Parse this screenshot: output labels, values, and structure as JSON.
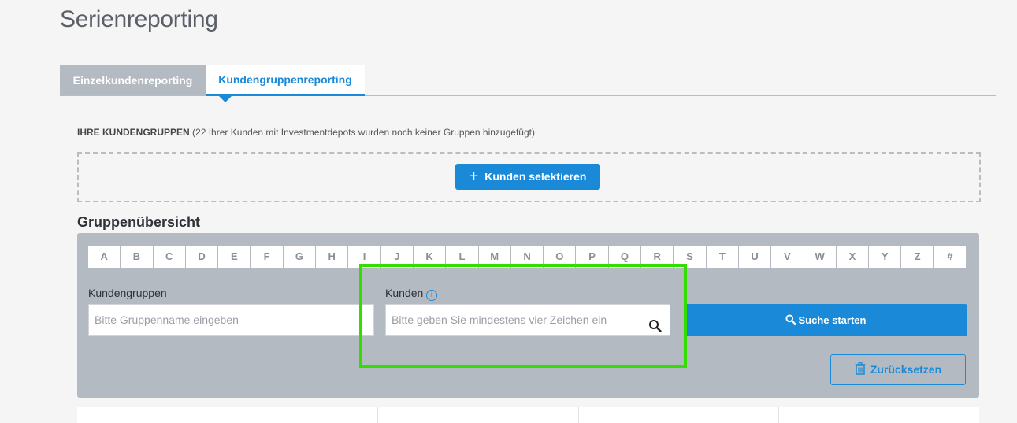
{
  "page_title": "Serienreporting",
  "tabs": [
    {
      "label": "Einzelkundenreporting",
      "active": false
    },
    {
      "label": "Kundengruppenreporting",
      "active": true
    }
  ],
  "groups": {
    "heading": "IHRE KUNDENGRUPPEN",
    "note": "(22 Ihrer Kunden mit Investmentdepots wurden noch keiner Gruppen hinzugefügt)",
    "select_button": "Kunden selektieren",
    "select_icon": "plus-icon"
  },
  "overview": {
    "title": "Gruppenübersicht",
    "letters": [
      "A",
      "B",
      "C",
      "D",
      "E",
      "F",
      "G",
      "H",
      "I",
      "J",
      "K",
      "L",
      "M",
      "N",
      "O",
      "P",
      "Q",
      "R",
      "S",
      "T",
      "U",
      "V",
      "W",
      "X",
      "Y",
      "Z",
      "#"
    ],
    "group_field": {
      "label": "Kundengruppen",
      "placeholder": "Bitte Gruppenname eingeben"
    },
    "customer_field": {
      "label": "Kunden",
      "placeholder": "Bitte geben Sie mindestens vier Zeichen ein",
      "info_icon": "info-icon"
    },
    "search_button": "Suche starten",
    "reset_button": "Zurücksetzen"
  },
  "colors": {
    "accent": "#1a8ad8",
    "panel": "#b4bac2",
    "highlight": "#33dd00"
  }
}
